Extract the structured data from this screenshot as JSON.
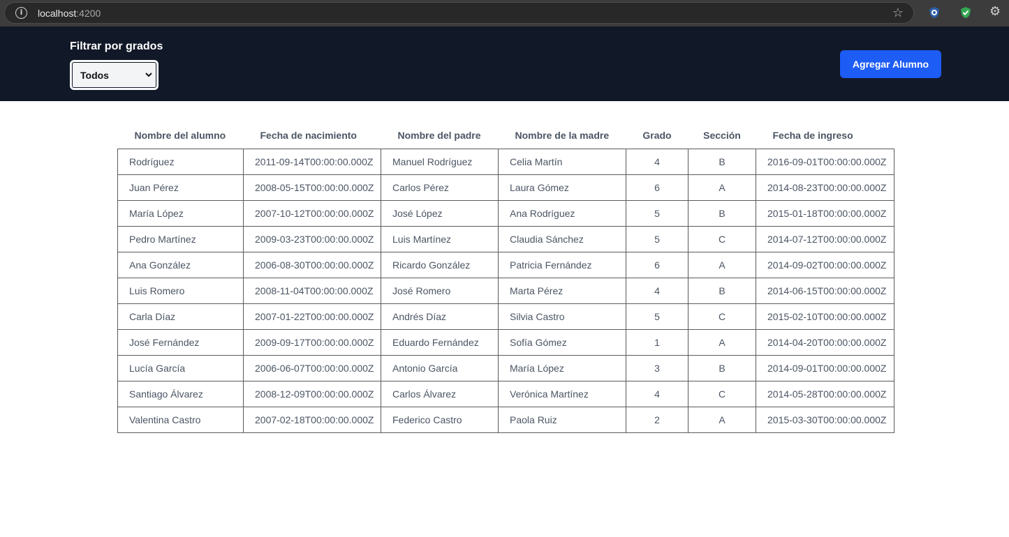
{
  "browser": {
    "url_host": "localhost",
    "url_port": ":4200"
  },
  "filter": {
    "label": "Filtrar por grados",
    "selected": "Todos"
  },
  "actions": {
    "add_label": "Agregar Alumno",
    "add_color": "#1d5cf5"
  },
  "table": {
    "headers": [
      "Nombre del alumno",
      "Fecha de nacimiento",
      "Nombre del padre",
      "Nombre de la madre",
      "Grado",
      "Sección",
      "Fecha de ingreso"
    ],
    "rows": [
      [
        "Rodríguez",
        "2011-09-14T00:00:00.000Z",
        "Manuel Rodríguez",
        "Celia Martín",
        "4",
        "B",
        "2016-09-01T00:00:00.000Z"
      ],
      [
        "Juan Pérez",
        "2008-05-15T00:00:00.000Z",
        "Carlos Pérez",
        "Laura Gómez",
        "6",
        "A",
        "2014-08-23T00:00:00.000Z"
      ],
      [
        "María López",
        "2007-10-12T00:00:00.000Z",
        "José López",
        "Ana Rodríguez",
        "5",
        "B",
        "2015-01-18T00:00:00.000Z"
      ],
      [
        "Pedro Martínez",
        "2009-03-23T00:00:00.000Z",
        "Luis Martínez",
        "Claudia Sánchez",
        "5",
        "C",
        "2014-07-12T00:00:00.000Z"
      ],
      [
        "Ana González",
        "2006-08-30T00:00:00.000Z",
        "Ricardo González",
        "Patricia Fernández",
        "6",
        "A",
        "2014-09-02T00:00:00.000Z"
      ],
      [
        "Luis Romero",
        "2008-11-04T00:00:00.000Z",
        "José Romero",
        "Marta Pérez",
        "4",
        "B",
        "2014-06-15T00:00:00.000Z"
      ],
      [
        "Carla Díaz",
        "2007-01-22T00:00:00.000Z",
        "Andrés Díaz",
        "Silvia Castro",
        "5",
        "C",
        "2015-02-10T00:00:00.000Z"
      ],
      [
        "José Fernández",
        "2009-09-17T00:00:00.000Z",
        "Eduardo Fernández",
        "Sofía Gómez",
        "1",
        "A",
        "2014-04-20T00:00:00.000Z"
      ],
      [
        "Lucía García",
        "2006-06-07T00:00:00.000Z",
        "Antonio García",
        "María López",
        "3",
        "B",
        "2014-09-01T00:00:00.000Z"
      ],
      [
        "Santiago Álvarez",
        "2008-12-09T00:00:00.000Z",
        "Carlos Álvarez",
        "Verónica Martínez",
        "4",
        "C",
        "2014-05-28T00:00:00.000Z"
      ],
      [
        "Valentina Castro",
        "2007-02-18T00:00:00.000Z",
        "Federico Castro",
        "Paola Ruiz",
        "2",
        "A",
        "2015-03-30T00:00:00.000Z"
      ]
    ]
  }
}
